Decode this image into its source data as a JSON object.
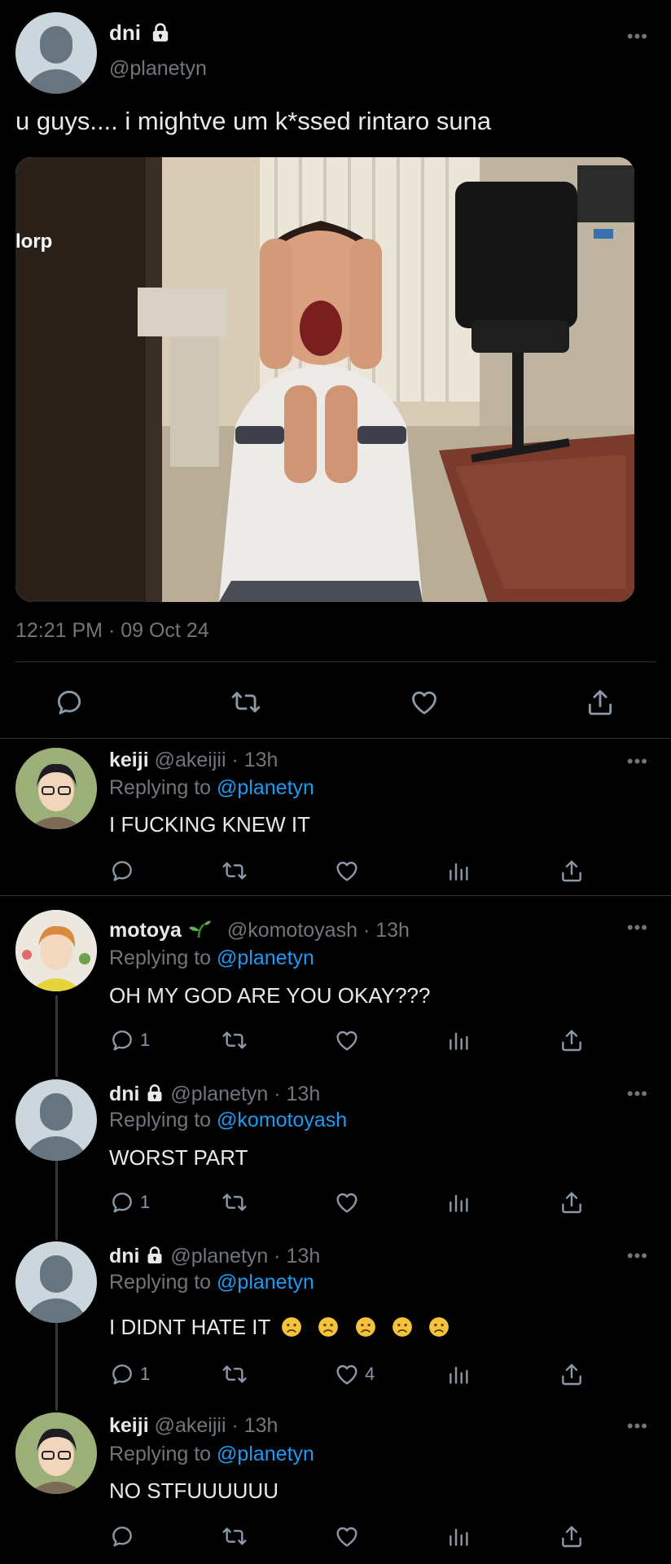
{
  "main_tweet": {
    "display_name": "dni",
    "handle": "@planetyn",
    "text": "u guys.... i mightve um k*ssed rintaro suna",
    "media_caption": "lorp",
    "timestamp": "12:21 PM · 09 Oct 24"
  },
  "replies": [
    {
      "display_name": "keiji",
      "handle": "@akeijii",
      "time": "· 13h",
      "replying_prefix": "Replying to",
      "replying_to": "@planetyn",
      "text": "I FUCKING KNEW IT",
      "reply_count": "",
      "like_count": ""
    },
    {
      "display_name": "motoya",
      "handle": "@komotoyash",
      "time": "· 13h",
      "replying_prefix": "Replying to",
      "replying_to": "@planetyn",
      "text": "OH MY GOD ARE YOU OKAY???",
      "reply_count": "1",
      "like_count": ""
    },
    {
      "display_name": "dni",
      "handle": "@planetyn",
      "time": "· 13h",
      "replying_prefix": "Replying to",
      "replying_to": "@komotoyash",
      "text": "WORST PART",
      "reply_count": "1",
      "like_count": ""
    },
    {
      "display_name": "dni",
      "handle": "@planetyn",
      "time": "· 13h",
      "replying_prefix": "Replying to",
      "replying_to": "@planetyn",
      "text": "I DIDNT HATE IT",
      "emojis": "🙁🙁🙁🙁🙁",
      "reply_count": "1",
      "like_count": "4"
    },
    {
      "display_name": "keiji",
      "handle": "@akeijii",
      "time": "· 13h",
      "replying_prefix": "Replying to",
      "replying_to": "@planetyn",
      "text": "NO STFUUUUUU",
      "reply_count": "",
      "like_count": ""
    }
  ],
  "icons": {
    "lock": "lock-icon",
    "sprout": "sprout-emoji",
    "reply": "reply-icon",
    "retweet": "retweet-icon",
    "like": "heart-icon",
    "views": "views-icon",
    "share": "share-icon",
    "more": "more-icon"
  },
  "colors": {
    "background": "#000000",
    "link": "#1d9bf0",
    "secondary_text": "#71767b",
    "divider": "#2f3336"
  }
}
